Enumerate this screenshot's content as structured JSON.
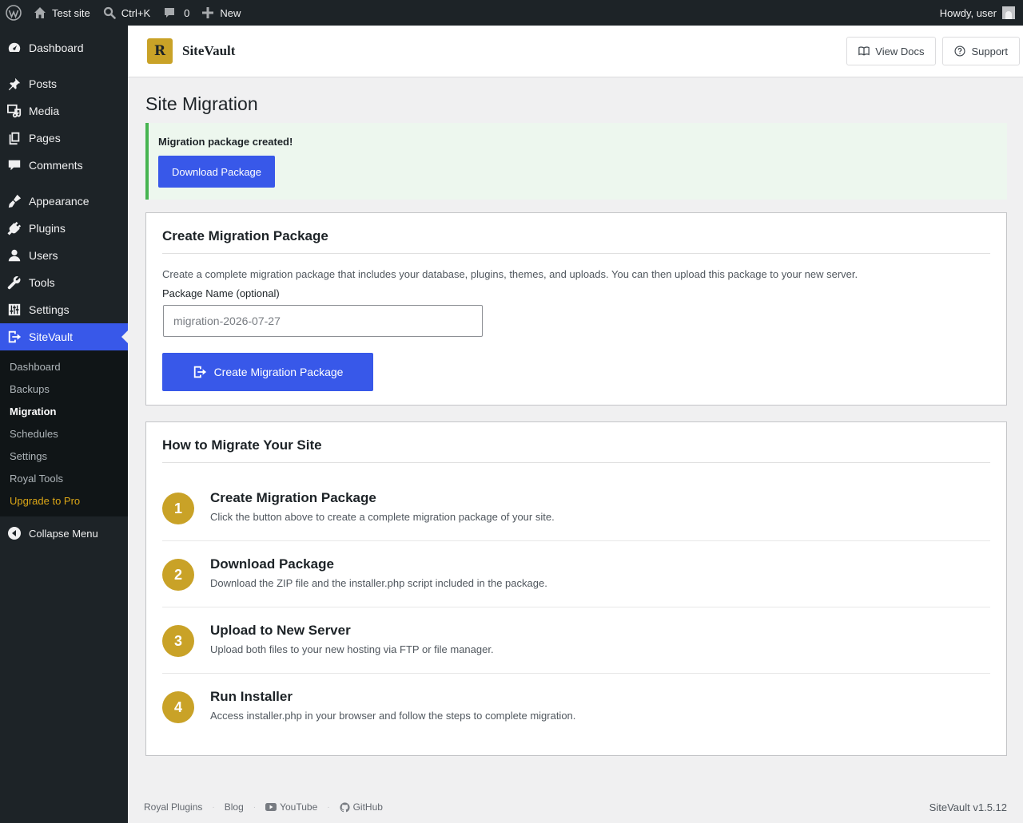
{
  "adminbar": {
    "site_name": "Test site",
    "search_shortcut": "Ctrl+K",
    "comments_count": "0",
    "new_label": "New",
    "greeting": "Howdy, user"
  },
  "sidebar": {
    "items": [
      {
        "label": "Dashboard",
        "icon": "dashboard-icon"
      },
      {
        "label": "Posts",
        "icon": "pin-icon"
      },
      {
        "label": "Media",
        "icon": "media-icon"
      },
      {
        "label": "Pages",
        "icon": "pages-icon"
      },
      {
        "label": "Comments",
        "icon": "comment-icon"
      },
      {
        "label": "Appearance",
        "icon": "brush-icon"
      },
      {
        "label": "Plugins",
        "icon": "plug-icon"
      },
      {
        "label": "Users",
        "icon": "user-icon"
      },
      {
        "label": "Tools",
        "icon": "wrench-icon"
      },
      {
        "label": "Settings",
        "icon": "sliders-icon"
      },
      {
        "label": "SiteVault",
        "icon": "migrate-icon"
      }
    ],
    "submenu": [
      "Dashboard",
      "Backups",
      "Migration",
      "Schedules",
      "Settings",
      "Royal Tools",
      "Upgrade to Pro"
    ],
    "collapse_label": "Collapse Menu"
  },
  "header": {
    "logo_letter": "R",
    "brand": "SiteVault",
    "view_docs": "View Docs",
    "support": "Support"
  },
  "page": {
    "title": "Site Migration"
  },
  "notice": {
    "title": "Migration package created!",
    "button": "Download Package"
  },
  "create_card": {
    "title": "Create Migration Package",
    "description": "Create a complete migration package that includes your database, plugins, themes, and uploads. You can then upload this package to your new server.",
    "field_label": "Package Name (optional)",
    "placeholder": "migration-2026-07-27",
    "button": "Create Migration Package"
  },
  "howto_card": {
    "title": "How to Migrate Your Site",
    "steps": [
      {
        "num": "1",
        "title": "Create Migration Package",
        "desc": "Click the button above to create a complete migration package of your site."
      },
      {
        "num": "2",
        "title": "Download Package",
        "desc": "Download the ZIP file and the installer.php script included in the package."
      },
      {
        "num": "3",
        "title": "Upload to New Server",
        "desc": "Upload both files to your new hosting via FTP or file manager."
      },
      {
        "num": "4",
        "title": "Run Installer",
        "desc": "Access installer.php in your browser and follow the steps to complete migration."
      }
    ]
  },
  "footer": {
    "links": [
      "Royal Plugins",
      "Blog",
      "YouTube",
      "GitHub"
    ],
    "version": "SiteVault v1.5.12"
  },
  "colors": {
    "accent": "#3858e9",
    "gold": "#c9a227",
    "success": "#46b450",
    "admin_dark": "#1d2327"
  }
}
